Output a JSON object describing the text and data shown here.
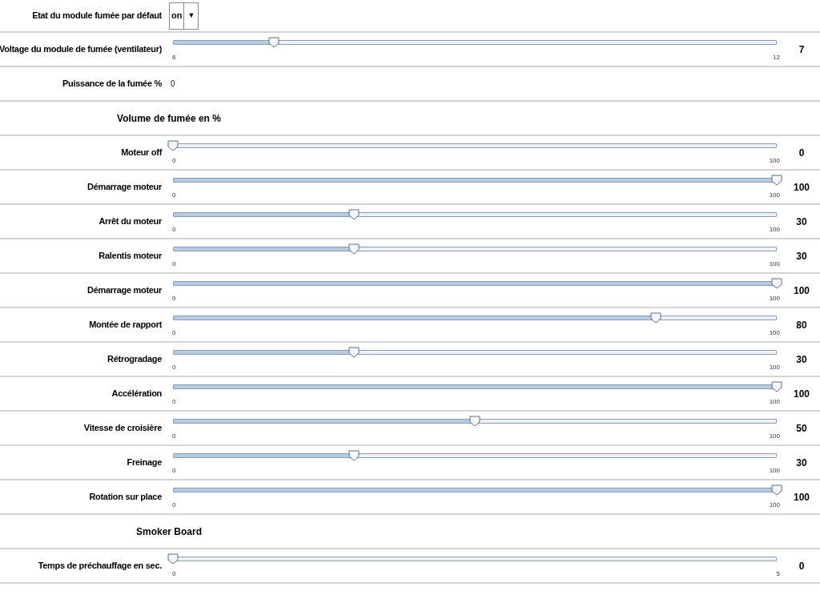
{
  "rows": [
    {
      "kind": "dropdown",
      "label": "Etat du module fumée par défaut",
      "value": "on",
      "arrow": "▼"
    },
    {
      "kind": "slider",
      "label": "Voltage du module de fumée (ventilateur)",
      "min": "6",
      "max": "12",
      "level": 0.1667,
      "reading": "7"
    },
    {
      "kind": "text",
      "label": "Puissance de la fumée %",
      "value": "0"
    },
    {
      "kind": "heading",
      "label": "Volume de fumée en %"
    },
    {
      "kind": "slider",
      "label": "Moteur off",
      "min": "0",
      "max": "100",
      "level": 0,
      "reading": "0"
    },
    {
      "kind": "slider",
      "label": "Démarrage moteur",
      "min": "0",
      "max": "100",
      "level": 1,
      "reading": "100"
    },
    {
      "kind": "slider",
      "label": "Arrêt du moteur",
      "min": "0",
      "max": "100",
      "level": 0.3,
      "reading": "30"
    },
    {
      "kind": "slider",
      "label": "Ralentis moteur",
      "min": "0",
      "max": "100",
      "level": 0.3,
      "reading": "30"
    },
    {
      "kind": "slider",
      "label": "Démarrage moteur",
      "min": "0",
      "max": "100",
      "level": 1,
      "reading": "100"
    },
    {
      "kind": "slider",
      "label": "Montée de rapport",
      "min": "0",
      "max": "100",
      "level": 0.8,
      "reading": "80"
    },
    {
      "kind": "slider",
      "label": "Rétrogradage",
      "min": "0",
      "max": "100",
      "level": 0.3,
      "reading": "30"
    },
    {
      "kind": "slider",
      "label": "Accélération",
      "min": "0",
      "max": "100",
      "level": 1,
      "reading": "100"
    },
    {
      "kind": "slider",
      "label": "Vitesse de croisière",
      "min": "0",
      "max": "100",
      "level": 0.5,
      "reading": "50"
    },
    {
      "kind": "slider",
      "label": "Freinage",
      "min": "0",
      "max": "100",
      "level": 0.3,
      "reading": "30"
    },
    {
      "kind": "slider",
      "label": "Rotation sur place",
      "min": "0",
      "max": "100",
      "level": 1,
      "reading": "100"
    },
    {
      "kind": "heading",
      "label": "Smoker Board"
    },
    {
      "kind": "slider",
      "label": "Temps de préchauffage en sec.",
      "min": "0",
      "max": "5",
      "level": 0,
      "reading": "0"
    }
  ]
}
